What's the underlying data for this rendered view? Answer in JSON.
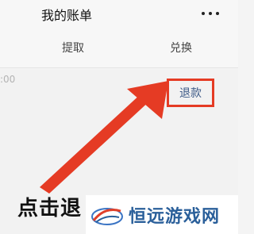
{
  "header": {
    "title": "我的账单",
    "more_icon": "more-horizontal-icon"
  },
  "tabs": [
    {
      "label": "提取"
    },
    {
      "label": "兑换"
    }
  ],
  "list": {
    "time_fragment": ":00",
    "refund_label": "退款"
  },
  "annotation": {
    "caption": "点击退",
    "arrow_color": "#e53b24"
  },
  "watermark": {
    "text": "恒远游戏网"
  }
}
